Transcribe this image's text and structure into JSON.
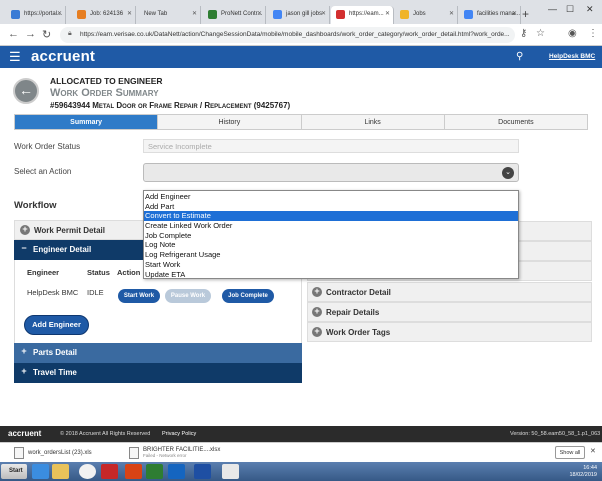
{
  "browser": {
    "tabs": [
      {
        "label": "https://portal...",
        "color": "#3a7bd5"
      },
      {
        "label": "Job: 624136",
        "color": "#e67e22"
      },
      {
        "label": "New Tab",
        "color": "#dee1e6"
      },
      {
        "label": "ProNett Contr...",
        "color": "#2e7d32"
      },
      {
        "label": "jason gill jobs",
        "color": "#4285f4"
      },
      {
        "label": "https://eam...",
        "color": "#d32f2f"
      },
      {
        "label": "Jobs",
        "color": "#f0b429"
      },
      {
        "label": "facilities mana...",
        "color": "#4285f4"
      }
    ],
    "url": "https://eam.verisae.co.uk/DataNett/action/ChangeSessionData/mobile/mobile_dashboards/work_order_category/work_order_detail.html?work_orde..."
  },
  "app": {
    "logo": "accruent",
    "user": "HelpDesk BMC"
  },
  "header": {
    "status": "ALLOCATED TO ENGINEER",
    "title": "Work Order Summary",
    "work_order": "#59643944 Metal Door or Frame Repair / Replacement (9425767)"
  },
  "tabs": [
    "Summary",
    "History",
    "Links",
    "Documents"
  ],
  "form": {
    "status_label": "Work Order Status",
    "status_value": "Service Incomplete",
    "action_label": "Select an Action"
  },
  "workflow": {
    "title": "Workflow",
    "left": [
      {
        "label": "Work Permit Detail",
        "sign": "+"
      },
      {
        "label": "Engineer Detail",
        "sign": "−"
      },
      {
        "label": "Parts Detail",
        "sign": "+"
      },
      {
        "label": "Travel Time",
        "sign": "+"
      }
    ],
    "right": [
      {
        "label": "Contractor Detail"
      },
      {
        "label": "Repair Details"
      },
      {
        "label": "Work Order Tags"
      }
    ],
    "engineer": {
      "headers": [
        "Engineer",
        "Status",
        "Action"
      ],
      "name": "HelpDesk BMC",
      "status": "IDLE",
      "start": "Start Work",
      "pause": "Pause Work",
      "complete": "Job Complete",
      "add": "Add Engineer"
    }
  },
  "dropdown": {
    "options": [
      "Add Engineer",
      "Add Part",
      "Convert to Estimate",
      "Create Linked Work Order",
      "Job Complete",
      "Log Note",
      "Log Refrigerant Usage",
      "Start Work",
      "Update ETA"
    ],
    "selected_index": 2
  },
  "footer": {
    "logo": "accruent",
    "copyright": "© 2018 Accruent All Rights Reserved",
    "privacy": "Privacy Policy",
    "version": "Version: 50_58.eam50_58_1.p1_063"
  },
  "downloads": {
    "items": [
      {
        "name": "work_ordersList (23).xls",
        "sub": ""
      },
      {
        "name": "BRIGHTER FACILITIE....xlsx",
        "sub": "Failed - Network error"
      }
    ],
    "show_all": "Show all"
  },
  "taskbar": {
    "start": "Start",
    "time": "16:44",
    "date": "18/02/2019"
  }
}
